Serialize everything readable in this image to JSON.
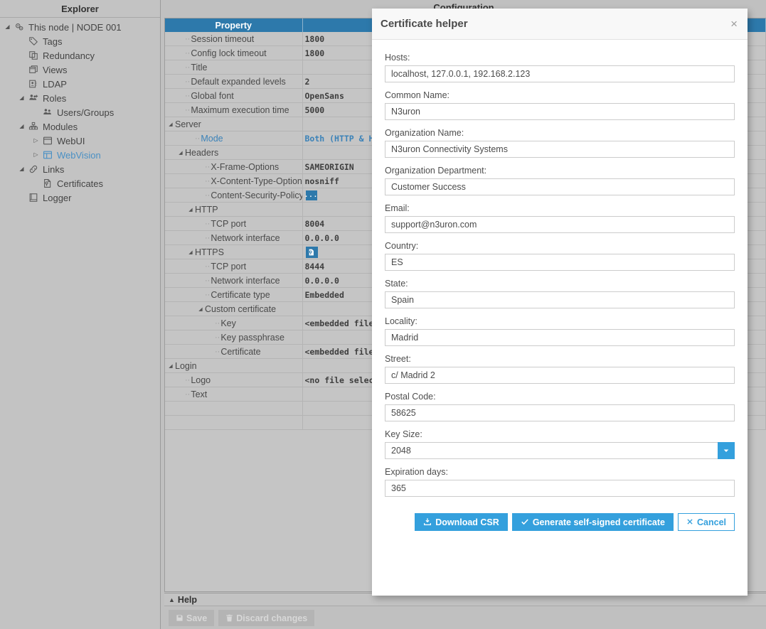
{
  "explorer": {
    "header": "Explorer",
    "items": [
      {
        "label": "This node | NODE 001",
        "icon": "gears-icon",
        "indent": 0,
        "twisty": "down",
        "selected": false
      },
      {
        "label": "Tags",
        "icon": "tag-icon",
        "indent": 1,
        "twisty": "none",
        "selected": false
      },
      {
        "label": "Redundancy",
        "icon": "copy-icon",
        "indent": 1,
        "twisty": "none",
        "selected": false
      },
      {
        "label": "Views",
        "icon": "windows-icon",
        "indent": 1,
        "twisty": "none",
        "selected": false
      },
      {
        "label": "LDAP",
        "icon": "contact-card-icon",
        "indent": 1,
        "twisty": "none",
        "selected": false
      },
      {
        "label": "Roles",
        "icon": "users-gear-icon",
        "indent": 1,
        "twisty": "down",
        "selected": false
      },
      {
        "label": "Users/Groups",
        "icon": "users-icon",
        "indent": 2,
        "twisty": "none",
        "selected": false
      },
      {
        "label": "Modules",
        "icon": "modules-icon",
        "indent": 1,
        "twisty": "down",
        "selected": false
      },
      {
        "label": "WebUI",
        "icon": "window-icon",
        "indent": 2,
        "twisty": "right",
        "selected": false
      },
      {
        "label": "WebVision",
        "icon": "layout-icon",
        "indent": 2,
        "twisty": "right",
        "selected": true
      },
      {
        "label": "Links",
        "icon": "link-icon",
        "indent": 1,
        "twisty": "down",
        "selected": false
      },
      {
        "label": "Certificates",
        "icon": "certificate-icon",
        "indent": 2,
        "twisty": "none",
        "selected": false
      },
      {
        "label": "Logger",
        "icon": "book-icon",
        "indent": 1,
        "twisty": "none",
        "selected": false
      }
    ]
  },
  "main": {
    "title": "Configuration",
    "columns": [
      "Property",
      ""
    ],
    "rows": [
      {
        "label": "Session timeout",
        "value": "1800",
        "indent": 1,
        "twisty": "none",
        "kind": "text"
      },
      {
        "label": "Config lock timeout",
        "value": "1800",
        "indent": 1,
        "twisty": "none",
        "kind": "text"
      },
      {
        "label": "Title",
        "value": "",
        "indent": 1,
        "twisty": "none",
        "kind": "text"
      },
      {
        "label": "Default expanded levels",
        "value": "2",
        "indent": 1,
        "twisty": "none",
        "kind": "text"
      },
      {
        "label": "Global font",
        "value": "OpenSans",
        "indent": 1,
        "twisty": "none",
        "kind": "text"
      },
      {
        "label": "Maximum execution time",
        "value": "5000",
        "indent": 1,
        "twisty": "none",
        "kind": "text"
      },
      {
        "label": "Server",
        "value": "",
        "indent": 0,
        "twisty": "down",
        "kind": "text"
      },
      {
        "label": "Mode",
        "value": "Both (HTTP & HTTPS)",
        "indent": 2,
        "twisty": "none",
        "kind": "link"
      },
      {
        "label": "Headers",
        "value": "",
        "indent": 1,
        "twisty": "down",
        "kind": "text"
      },
      {
        "label": "X-Frame-Options",
        "value": "SAMEORIGIN",
        "indent": 3,
        "twisty": "none",
        "kind": "text"
      },
      {
        "label": "X-Content-Type-Options",
        "value": "nosniff",
        "indent": 3,
        "twisty": "none",
        "kind": "text"
      },
      {
        "label": "Content-Security-Policy",
        "value": "...",
        "indent": 3,
        "twisty": "none",
        "kind": "dots"
      },
      {
        "label": "HTTP",
        "value": "",
        "indent": 2,
        "twisty": "down",
        "kind": "text"
      },
      {
        "label": "TCP port",
        "value": "8004",
        "indent": 3,
        "twisty": "none",
        "kind": "text"
      },
      {
        "label": "Network interface",
        "value": "0.0.0.0",
        "indent": 3,
        "twisty": "none",
        "kind": "text"
      },
      {
        "label": "HTTPS",
        "value": "",
        "indent": 2,
        "twisty": "down",
        "kind": "cert"
      },
      {
        "label": "TCP port",
        "value": "8444",
        "indent": 3,
        "twisty": "none",
        "kind": "text"
      },
      {
        "label": "Network interface",
        "value": "0.0.0.0",
        "indent": 3,
        "twisty": "none",
        "kind": "text"
      },
      {
        "label": "Certificate type",
        "value": "Embedded",
        "indent": 3,
        "twisty": "none",
        "kind": "text"
      },
      {
        "label": "Custom certificate",
        "value": "",
        "indent": 3,
        "twisty": "down",
        "kind": "text"
      },
      {
        "label": "Key",
        "value": "<embedded file>",
        "indent": 4,
        "twisty": "none",
        "kind": "text"
      },
      {
        "label": "Key passphrase",
        "value": "",
        "indent": 4,
        "twisty": "none",
        "kind": "text"
      },
      {
        "label": "Certificate",
        "value": "<embedded file>",
        "indent": 4,
        "twisty": "none",
        "kind": "text"
      },
      {
        "label": "Login",
        "value": "",
        "indent": 0,
        "twisty": "down",
        "kind": "text"
      },
      {
        "label": "Logo",
        "value": "<no file selected>",
        "indent": 1,
        "twisty": "none",
        "kind": "text"
      },
      {
        "label": "Text",
        "value": "",
        "indent": 1,
        "twisty": "none",
        "kind": "text"
      }
    ],
    "help_label": "Help",
    "save_label": "Save",
    "discard_label": "Discard changes"
  },
  "dialog": {
    "title": "Certificate helper",
    "close_label": "×",
    "fields": [
      {
        "label": "Hosts:",
        "value": "localhost, 127.0.0.1, 192.168.2.123",
        "type": "text"
      },
      {
        "label": "Common Name:",
        "value": "N3uron",
        "type": "text"
      },
      {
        "label": "Organization Name:",
        "value": "N3uron Connectivity Systems",
        "type": "text"
      },
      {
        "label": "Organization Department:",
        "value": "Customer Success",
        "type": "text"
      },
      {
        "label": "Email:",
        "value": "support@n3uron.com",
        "type": "text"
      },
      {
        "label": "Country:",
        "value": "ES",
        "type": "text"
      },
      {
        "label": "State:",
        "value": "Spain",
        "type": "text"
      },
      {
        "label": "Locality:",
        "value": "Madrid",
        "type": "text"
      },
      {
        "label": "Street:",
        "value": "c/ Madrid 2",
        "type": "text"
      },
      {
        "label": "Postal Code:",
        "value": "58625",
        "type": "text"
      },
      {
        "label": "Key Size:",
        "value": "2048",
        "type": "select"
      },
      {
        "label": "Expiration days:",
        "value": "365",
        "type": "text"
      }
    ],
    "buttons": [
      {
        "label": "Download CSR",
        "style": "primary",
        "icon": "download-icon"
      },
      {
        "label": "Generate self-signed certificate",
        "style": "primary",
        "icon": "check-icon"
      },
      {
        "label": "Cancel",
        "style": "ghost",
        "icon": "x-icon"
      }
    ]
  },
  "colors": {
    "accent_blue": "#34a0dd",
    "header_blue": "#2d79ab",
    "panel_gray": "#c3c3c3",
    "link_blue": "#3b82b8"
  }
}
